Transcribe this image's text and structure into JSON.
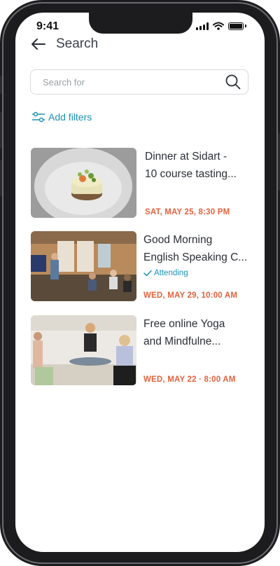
{
  "status_bar": {
    "time": "9:41"
  },
  "header": {
    "title": "Search"
  },
  "search": {
    "placeholder": "Search for",
    "value": ""
  },
  "filters": {
    "label": "Add filters"
  },
  "events": [
    {
      "title_line1": "Dinner at Sidart -",
      "title_line2": "10 course tasting...",
      "attending": "",
      "date": "SAT, MAY 25, 8:30 PM"
    },
    {
      "title_line1": "Good Morning",
      "title_line2": "English Speaking C...",
      "attending": "Attending",
      "date": "WED, MAY 29, 10:00 AM"
    },
    {
      "title_line1": "Free online Yoga",
      "title_line2": "and Mindfulne...",
      "attending": "",
      "date": "WED, MAY 22 · 8:00 AM"
    }
  ],
  "colors": {
    "accent": "#1b8fb5",
    "date": "#e3623d",
    "text": "#2b2f36"
  },
  "icons": [
    "back-arrow-icon",
    "search-icon",
    "filters-sliders-icon",
    "checkmark-icon",
    "signal-icon",
    "wifi-icon",
    "battery-icon"
  ]
}
